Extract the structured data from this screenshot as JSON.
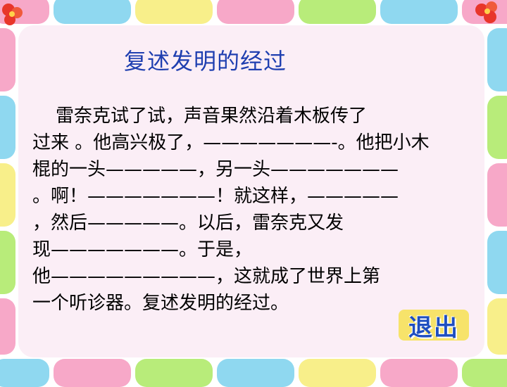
{
  "title": "复述发明的经过",
  "paragraph": [
    "    雷奈克试了试，声音果然沿着木板传了",
    "过来 。他高兴极了，———————-。他把小木",
    "棍的一头—————，另一头———————",
    "。啊！———————！就这样，—————",
    "，然后—————。以后，雷奈克又发",
    "现———————。于是，",
    "他—————————，这就成了世界上第",
    "一个听诊器。复述发明的经过。"
  ],
  "exit_button": {
    "label": "退出"
  },
  "colors": {
    "title": "#1f3fb0",
    "panel": "#fbeef6",
    "tile_pink": "#f7a8c8",
    "tile_blue": "#8fd8f0",
    "tile_yellow": "#f8ef8a",
    "tile_green": "#b8ec7a",
    "exit_bg": "#f7e36a",
    "exit_text": "#1f4fc0"
  },
  "icons": [
    "flower-icon-left",
    "flower-icon-right"
  ]
}
